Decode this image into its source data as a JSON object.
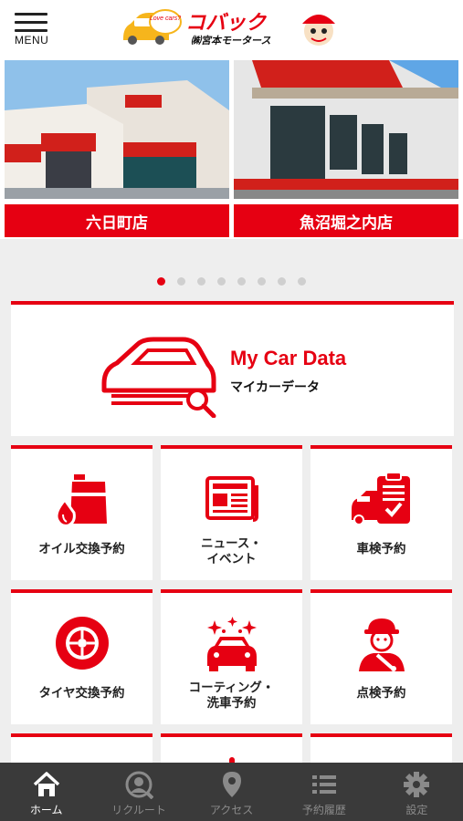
{
  "header": {
    "menu_label": "MENU",
    "logo_tagline": "Love cars?",
    "logo_brand": "コバック",
    "logo_company": "㈱宮本モータース"
  },
  "stores": [
    {
      "name": "六日町店"
    },
    {
      "name": "魚沼堀之内店"
    }
  ],
  "carousel": {
    "count": 8,
    "active": 0
  },
  "mycar": {
    "title": "My Car Data",
    "subtitle": "マイカーデータ"
  },
  "tiles": [
    {
      "label": "オイル交換予約",
      "icon": "oil-icon"
    },
    {
      "label_line1": "ニュース・",
      "label_line2": "イベント",
      "icon": "news-icon"
    },
    {
      "label": "車検予約",
      "icon": "inspection-icon"
    },
    {
      "label": "タイヤ交換予約",
      "icon": "tire-icon"
    },
    {
      "label_line1": "コーティング・",
      "label_line2": "洗車予約",
      "icon": "coating-icon"
    },
    {
      "label": "点検予約",
      "icon": "mechanic-icon"
    }
  ],
  "tabbar": [
    {
      "label": "ホーム",
      "icon": "home-icon"
    },
    {
      "label": "リクルート",
      "icon": "recruit-icon"
    },
    {
      "label": "アクセス",
      "icon": "location-icon"
    },
    {
      "label": "予約履歴",
      "icon": "list-icon"
    },
    {
      "label": "設定",
      "icon": "gear-icon"
    }
  ],
  "colors": {
    "accent": "#e60012",
    "tabbar": "#3a3a3a",
    "active_tab": "#ffffff",
    "inactive_tab": "#8a8a8a"
  }
}
